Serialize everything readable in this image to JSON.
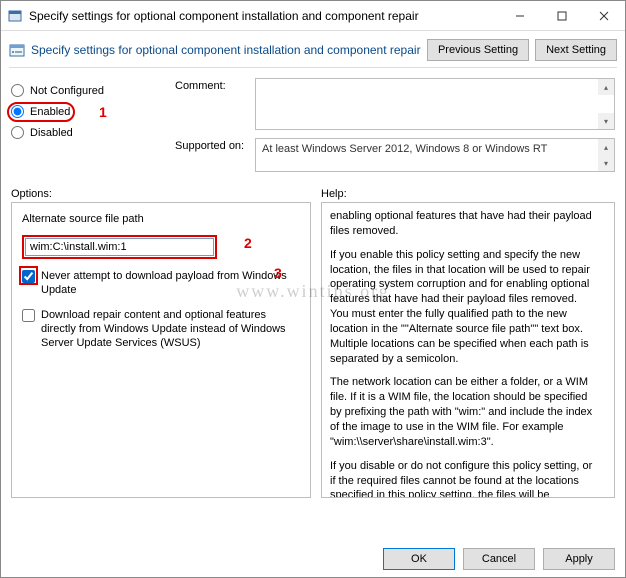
{
  "window": {
    "title": "Specify settings for optional component installation and component repair"
  },
  "header": {
    "description": "Specify settings for optional component installation and component repair",
    "prev_btn": "Previous Setting",
    "next_btn": "Next Setting"
  },
  "state": {
    "not_configured": "Not Configured",
    "enabled": "Enabled",
    "disabled": "Disabled"
  },
  "fields": {
    "comment_label": "Comment:",
    "supported_label": "Supported on:",
    "supported_text": "At least Windows Server 2012, Windows 8 or Windows RT"
  },
  "labels": {
    "options": "Options:",
    "help": "Help:"
  },
  "options": {
    "alt_path_label": "Alternate source file path",
    "alt_path_value": "wim:C:\\install.wim:1",
    "never_download": "Never attempt to download payload from Windows Update",
    "download_repair": "Download repair content and optional features directly from Windows Update instead of Windows Server Update Services (WSUS)"
  },
  "help": {
    "p1": "enabling optional features that have had their payload files removed.",
    "p2": "If you enable this policy setting and specify the new location, the files in that location will be used to repair operating system corruption and for enabling optional features that have had their payload files removed. You must enter the fully qualified path to the new location in the \"\"Alternate source file path\"\" text box. Multiple locations can be specified when each path is separated by a semicolon.",
    "p3": "The network location can be either a folder, or a WIM file. If it is a WIM file, the location should be specified by prefixing the path with \"wim:\" and include the index of the image to use in the WIM file. For example \"wim:\\\\server\\share\\install.wim:3\".",
    "p4": "If you disable or do not configure this policy setting, or if the required files cannot be found at the locations specified in this policy setting, the files will be downloaded from Windows Update, if that is allowed by the policy settings for the computer."
  },
  "markers": {
    "m1": "1",
    "m2": "2",
    "m3": "3"
  },
  "footer": {
    "ok": "OK",
    "cancel": "Cancel",
    "apply": "Apply"
  },
  "watermark": "www.wintips.org"
}
